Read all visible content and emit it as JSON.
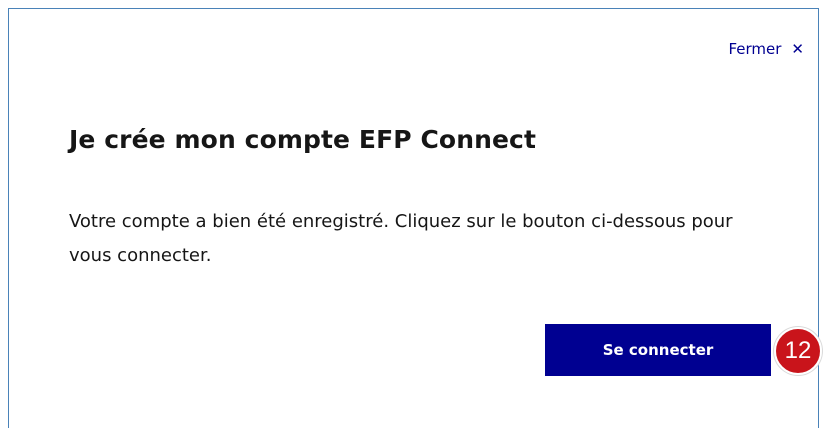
{
  "header": {
    "close_label": "Fermer",
    "close_icon": "close-icon"
  },
  "main": {
    "title": "Je crée mon compte EFP Connect",
    "message": "Votre compte a bien été enregistré. Cliquez sur le bouton ci-dessous pour vous connecter.",
    "connect_button_label": "Se connecter"
  },
  "annotation": {
    "step_number": "12"
  },
  "colors": {
    "primary": "#000091",
    "text": "#161616",
    "badge": "#c9141b",
    "border": "#4a82b8"
  }
}
